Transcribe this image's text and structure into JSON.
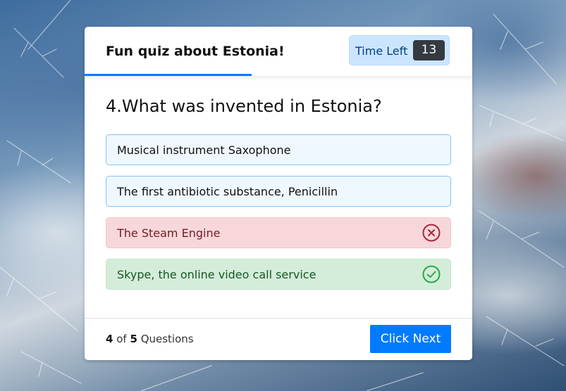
{
  "quiz": {
    "title": "Fun quiz about Estonia!",
    "timer_label": "Time Left",
    "timer_value": "13",
    "question": "4.What was invented in Estonia?",
    "options": [
      {
        "label": "Musical instrument Saxophone",
        "state": "default"
      },
      {
        "label": "The first antibiotic substance, Penicillin",
        "state": "default"
      },
      {
        "label": "The Steam Engine",
        "state": "wrong",
        "icon": "cross-circle-icon"
      },
      {
        "label": "Skype, the online video call service",
        "state": "correct",
        "icon": "check-circle-icon"
      }
    ]
  },
  "footer": {
    "current": "4",
    "of_word": "of",
    "total": "5",
    "questions_word": "Questions",
    "next_label": "Click Next"
  },
  "colors": {
    "accent": "#007bff",
    "wrong": "#a72834",
    "correct": "#28a745",
    "timer_bg": "#cce5ff",
    "timer_badge": "#343a40"
  }
}
